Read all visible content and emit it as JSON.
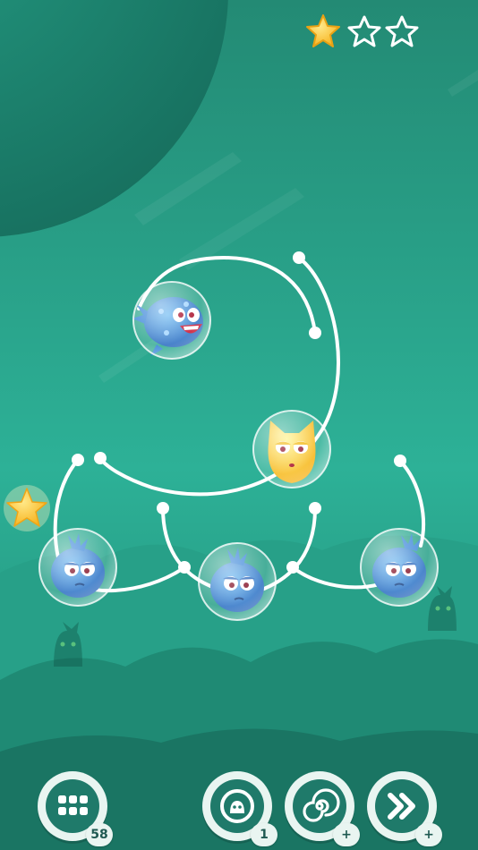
{
  "game": {
    "stars_earned": 1,
    "stars_total": 3,
    "colors": {
      "background": "#2a9c86",
      "planet": "#1f8a74",
      "track": "#ffffff",
      "blue_monster": "#2f7fd6",
      "yellow_monster": "#ffcc1a",
      "star_gold": "#ffc83a"
    },
    "creatures": [
      {
        "name": "blue-monster-smiling",
        "icon": "blue-monster"
      },
      {
        "name": "yellow-cat-monster",
        "icon": "yellow-monster"
      },
      {
        "name": "blue-monster-left",
        "icon": "blue-monster"
      },
      {
        "name": "blue-monster-center",
        "icon": "blue-monster"
      },
      {
        "name": "blue-monster-right",
        "icon": "blue-monster"
      }
    ],
    "collectible_star": {
      "icon": "star-icon"
    }
  },
  "toolbar": {
    "levels": {
      "icon": "grid-menu-icon",
      "badge": "58"
    },
    "hint": {
      "icon": "ghost-hint-icon",
      "badge": "1"
    },
    "slow_motion": {
      "icon": "spiral-icon",
      "badge": "+"
    },
    "skip": {
      "icon": "fast-forward-icon",
      "badge": "+"
    }
  }
}
